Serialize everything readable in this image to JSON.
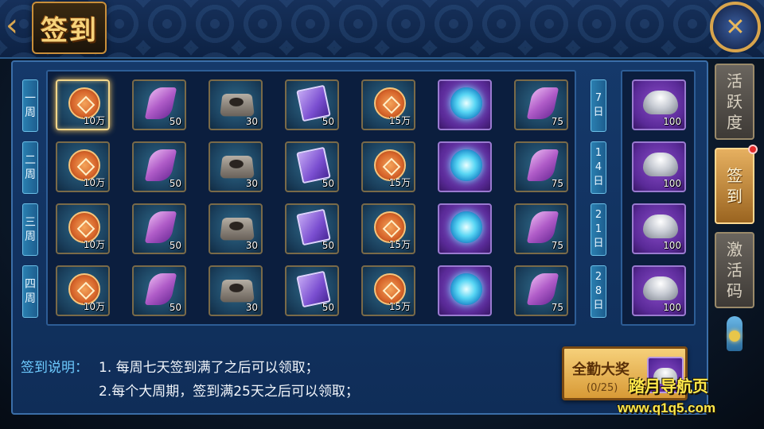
{
  "header": {
    "title": "签到"
  },
  "weeks": [
    {
      "label": "一周",
      "milestone": "7日",
      "bonus_qty": "100",
      "items": [
        {
          "icon": "coin-icon",
          "qty": "10万",
          "bg": "teal"
        },
        {
          "icon": "scroll-icon",
          "qty": "50",
          "bg": "teal"
        },
        {
          "icon": "inkstone-icon",
          "qty": "30",
          "bg": "teal"
        },
        {
          "icon": "book-icon",
          "qty": "50",
          "bg": "teal"
        },
        {
          "icon": "coin-icon",
          "qty": "15万",
          "bg": "teal"
        },
        {
          "icon": "orb-icon",
          "qty": "",
          "bg": "purple"
        },
        {
          "icon": "scroll-icon",
          "qty": "75",
          "bg": "teal"
        }
      ]
    },
    {
      "label": "二周",
      "milestone": "14日",
      "bonus_qty": "100",
      "items": [
        {
          "icon": "coin-icon",
          "qty": "10万",
          "bg": "teal"
        },
        {
          "icon": "scroll-icon",
          "qty": "50",
          "bg": "teal"
        },
        {
          "icon": "inkstone-icon",
          "qty": "30",
          "bg": "teal"
        },
        {
          "icon": "book-icon",
          "qty": "50",
          "bg": "teal"
        },
        {
          "icon": "coin-icon",
          "qty": "15万",
          "bg": "teal"
        },
        {
          "icon": "orb-icon",
          "qty": "",
          "bg": "purple"
        },
        {
          "icon": "scroll-icon",
          "qty": "75",
          "bg": "teal"
        }
      ]
    },
    {
      "label": "三周",
      "milestone": "21日",
      "bonus_qty": "100",
      "items": [
        {
          "icon": "coin-icon",
          "qty": "10万",
          "bg": "teal"
        },
        {
          "icon": "scroll-icon",
          "qty": "50",
          "bg": "teal"
        },
        {
          "icon": "inkstone-icon",
          "qty": "30",
          "bg": "teal"
        },
        {
          "icon": "book-icon",
          "qty": "50",
          "bg": "teal"
        },
        {
          "icon": "coin-icon",
          "qty": "15万",
          "bg": "teal"
        },
        {
          "icon": "orb-icon",
          "qty": "",
          "bg": "purple"
        },
        {
          "icon": "scroll-icon",
          "qty": "75",
          "bg": "teal"
        }
      ]
    },
    {
      "label": "四周",
      "milestone": "28日",
      "bonus_qty": "100",
      "items": [
        {
          "icon": "coin-icon",
          "qty": "10万",
          "bg": "teal"
        },
        {
          "icon": "scroll-icon",
          "qty": "50",
          "bg": "teal"
        },
        {
          "icon": "inkstone-icon",
          "qty": "30",
          "bg": "teal"
        },
        {
          "icon": "book-icon",
          "qty": "50",
          "bg": "teal"
        },
        {
          "icon": "coin-icon",
          "qty": "15万",
          "bg": "teal"
        },
        {
          "icon": "orb-icon",
          "qty": "",
          "bg": "purple"
        },
        {
          "icon": "scroll-icon",
          "qty": "75",
          "bg": "teal"
        }
      ]
    }
  ],
  "bonus_icon": "ingot-icon",
  "selected": {
    "week": 0,
    "day": 0
  },
  "tabs": [
    {
      "label": "活跃度",
      "active": false,
      "badge": false
    },
    {
      "label": "签到",
      "active": true,
      "badge": true
    },
    {
      "label": "激活码",
      "active": false,
      "badge": false
    }
  ],
  "description": {
    "label": "签到说明：",
    "line1": "1. 每周七天签到满了之后可以领取；",
    "line2": "2.每个大周期，签到满25天之后可以领取；"
  },
  "reward": {
    "title": "全勤大奖",
    "progress": "(0/25)"
  },
  "watermark": {
    "line1": "踏月导航页",
    "line2": "www.q1q5.com"
  },
  "colors": {
    "accent_gold": "#d8a44c",
    "label_blue": "#6ecbff",
    "badge_red": "#e02a2a"
  }
}
